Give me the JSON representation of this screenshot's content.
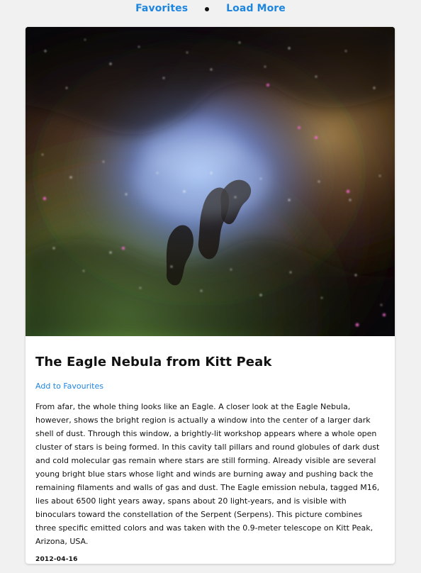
{
  "nav": {
    "favorites_label": "Favorites",
    "load_more_label": "Load More"
  },
  "article": {
    "image_alt": "Eagle Nebula",
    "title": "The Eagle Nebula from Kitt Peak",
    "add_favourites_label": "Add to Favourites",
    "description": "From afar, the whole thing looks like an Eagle. A closer look at the Eagle Nebula, however, shows the bright region is actually a window into the center of a larger dark shell of dust. Through this window, a brightly-lit workshop appears where a whole open cluster of stars is being formed. In this cavity tall pillars and round globules of dark dust and cold molecular gas remain where stars are still forming. Already visible are several young bright blue stars whose light and winds are burning away and pushing back the remaining filaments and walls of gas and dust. The Eagle emission nebula, tagged M16, lies about 6500 light years away, spans about 20 light-years, and is visible with binoculars toward the constellation of the Serpent (Serpens). This picture combines three specific emitted colors and was taken with the 0.9-meter telescope on Kitt Peak, Arizona, USA.",
    "date": "2012-04-16"
  },
  "colors": {
    "link_blue": "#1f86e0",
    "page_bg": "#f1f1f1",
    "card_bg": "#ffffff"
  }
}
